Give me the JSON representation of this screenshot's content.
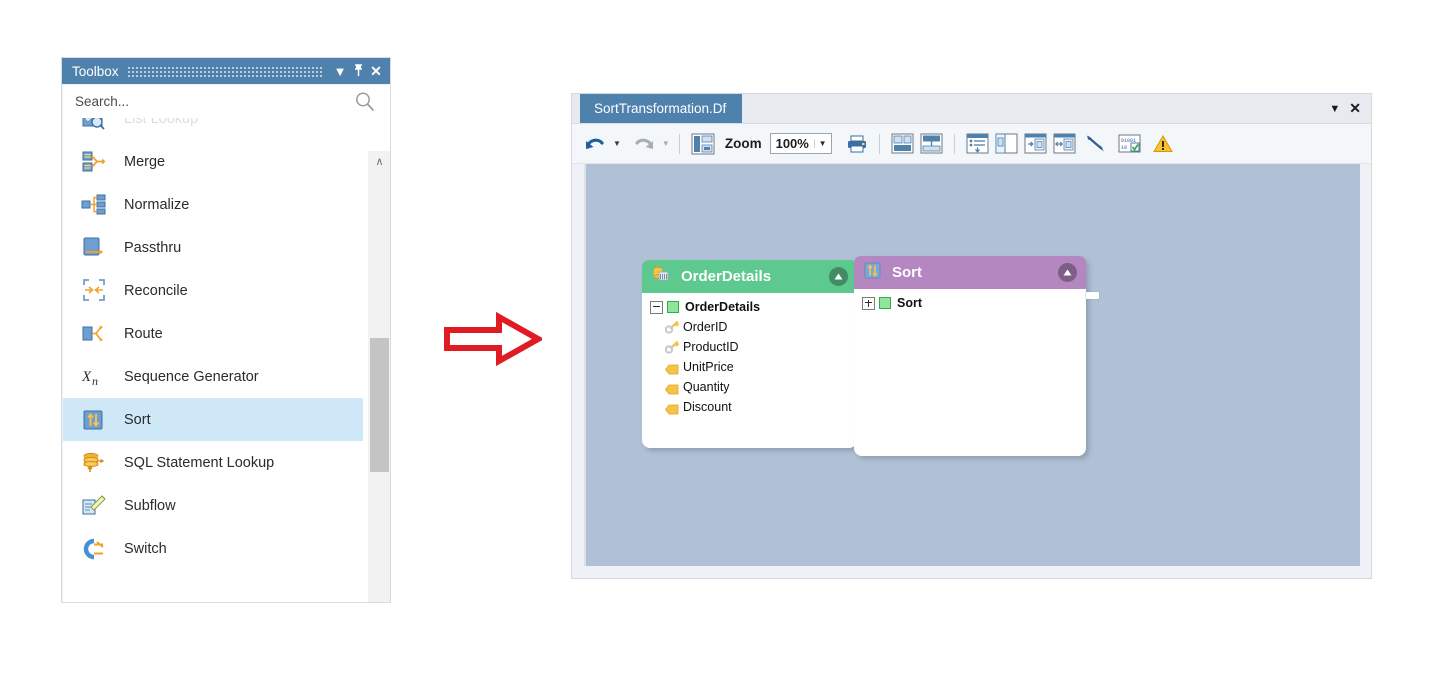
{
  "toolbox": {
    "title": "Toolbox",
    "buttons": [
      {
        "name": "dropdown",
        "glyph": "▼"
      },
      {
        "name": "auto-hide-pin",
        "glyph": "⍠"
      },
      {
        "name": "close",
        "glyph": "✕"
      }
    ],
    "search": {
      "placeholder": "Search...",
      "value": "",
      "icon": "search-icon"
    },
    "items": [
      {
        "label": "List Lookup",
        "icon": "list-lookup-icon",
        "selected": false,
        "clipped": true
      },
      {
        "label": "Merge",
        "icon": "merge-icon",
        "selected": false
      },
      {
        "label": "Normalize",
        "icon": "normalize-icon",
        "selected": false
      },
      {
        "label": "Passthru",
        "icon": "passthru-icon",
        "selected": false
      },
      {
        "label": "Reconcile",
        "icon": "reconcile-icon",
        "selected": false
      },
      {
        "label": "Route",
        "icon": "route-icon",
        "selected": false
      },
      {
        "label": "Sequence Generator",
        "icon": "sequence-generator-icon",
        "selected": false
      },
      {
        "label": "Sort",
        "icon": "sort-icon",
        "selected": true
      },
      {
        "label": "SQL Statement Lookup",
        "icon": "sql-statement-lookup-icon",
        "selected": false
      },
      {
        "label": "Subflow",
        "icon": "subflow-icon",
        "selected": false
      },
      {
        "label": "Switch",
        "icon": "switch-icon",
        "selected": false
      }
    ],
    "scrollbar": {
      "up_glyph": "∧",
      "down_glyph": "∨"
    }
  },
  "annotation": {
    "arrow": "right-arrow",
    "color": "#e01b24"
  },
  "designer": {
    "tab": {
      "label": "SortTransformation.Df"
    },
    "window_buttons": [
      {
        "name": "tab-dropdown",
        "glyph": "▼"
      },
      {
        "name": "tab-close",
        "glyph": "✕"
      }
    ],
    "toolbar": {
      "undo": "undo-icon",
      "undo_dropdown": "▼",
      "redo": "redo-icon",
      "redo_dropdown": "▼",
      "layout": "layout-icon",
      "zoom_label": "Zoom",
      "zoom_value": "100%",
      "zoom_arrow": "▼",
      "print": "print-icon",
      "icons": [
        "align-horizontal-icon",
        "align-vertical-icon",
        "list-down-icon",
        "panel-left-icon",
        "panel-expand-left-icon",
        "panel-expand-both-icon",
        "diagonal-line-icon",
        "binary-check-icon",
        "warning-icon"
      ]
    },
    "canvas": {
      "background_color": "#b0c1d5",
      "nodes": [
        {
          "id": "order-details",
          "title": "OrderDetails",
          "header_color": "#5dc98f",
          "header_icon": "database-table-icon",
          "collapse_glyph": "▲",
          "root": {
            "label": "OrderDetails",
            "expander": "minus",
            "icon": "green-square-icon"
          },
          "fields": [
            {
              "label": "OrderID",
              "icon": "key-icon"
            },
            {
              "label": "ProductID",
              "icon": "key-icon"
            },
            {
              "label": "UnitPrice",
              "icon": "attribute-icon"
            },
            {
              "label": "Quantity",
              "icon": "attribute-icon"
            },
            {
              "label": "Discount",
              "icon": "attribute-icon"
            }
          ],
          "output_stub_count": 6
        },
        {
          "id": "sort",
          "title": "Sort",
          "header_color": "#b487c1",
          "header_icon": "sort-icon",
          "collapse_glyph": "▲",
          "root": {
            "label": "Sort",
            "expander": "plus",
            "icon": "green-square-icon"
          },
          "fields": [],
          "output_stub_count": 1,
          "has_input_marker": true
        }
      ]
    }
  }
}
